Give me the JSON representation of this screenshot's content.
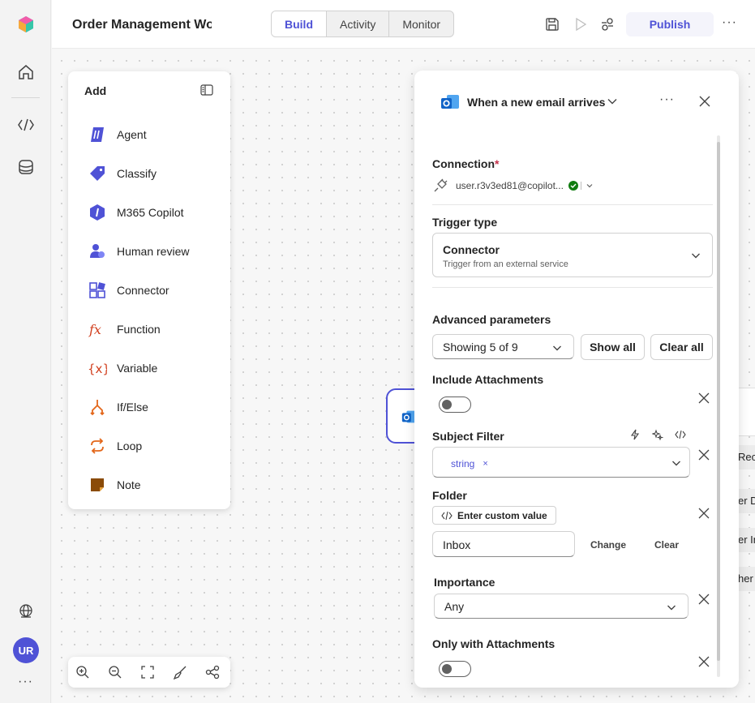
{
  "rail": {
    "icons": [
      "app-logo",
      "home-icon",
      "code-brackets-icon",
      "layers-icon",
      "globe-icon"
    ],
    "avatar_initials": "UR",
    "more": "···"
  },
  "header": {
    "title": "Order Management Wo",
    "tabs": [
      {
        "label": "Build",
        "active": true
      },
      {
        "label": "Activity",
        "active": false
      },
      {
        "label": "Monitor",
        "active": false
      }
    ],
    "publish_label": "Publish",
    "more": "···"
  },
  "add_panel": {
    "title": "Add",
    "items": [
      {
        "label": "Agent",
        "icon": "agent-icon"
      },
      {
        "label": "Classify",
        "icon": "classify-icon"
      },
      {
        "label": "M365 Copilot",
        "icon": "copilot-icon"
      },
      {
        "label": "Human review",
        "icon": "human-review-icon"
      },
      {
        "label": "Connector",
        "icon": "connector-icon"
      },
      {
        "label": "Function",
        "icon": "function-icon"
      },
      {
        "label": "Variable",
        "icon": "variable-icon"
      },
      {
        "label": "If/Else",
        "icon": "branch-icon"
      },
      {
        "label": "Loop",
        "icon": "loop-icon"
      },
      {
        "label": "Note",
        "icon": "note-icon"
      }
    ]
  },
  "canvas": {
    "peek_rows": [
      "Rec",
      "er D",
      "er In",
      "her"
    ]
  },
  "props": {
    "title": "When a new email arrives",
    "more": "···",
    "connection": {
      "label": "Connection",
      "required_mark": "*",
      "account": "user.r3v3ed81@copilot...",
      "status_color": "#107c10"
    },
    "trigger_type": {
      "label": "Trigger type",
      "value": "Connector",
      "description": "Trigger from an external service"
    },
    "advanced": {
      "label": "Advanced parameters",
      "showing": "Showing 5 of 9",
      "show_all": "Show all",
      "clear_all": "Clear all"
    },
    "include_attachments": {
      "label": "Include Attachments",
      "on": false
    },
    "subject_filter": {
      "label": "Subject Filter",
      "tag": "string",
      "tag_remove": "×"
    },
    "folder": {
      "label": "Folder",
      "custom_value": "Enter custom value",
      "value": "Inbox",
      "change": "Change",
      "clear": "Clear"
    },
    "importance": {
      "label": "Importance",
      "value": "Any"
    },
    "only_with_attachments": {
      "label": "Only with Attachments",
      "on": false
    }
  },
  "colors": {
    "accent": "#4f52d6",
    "required": "#c4314b"
  }
}
